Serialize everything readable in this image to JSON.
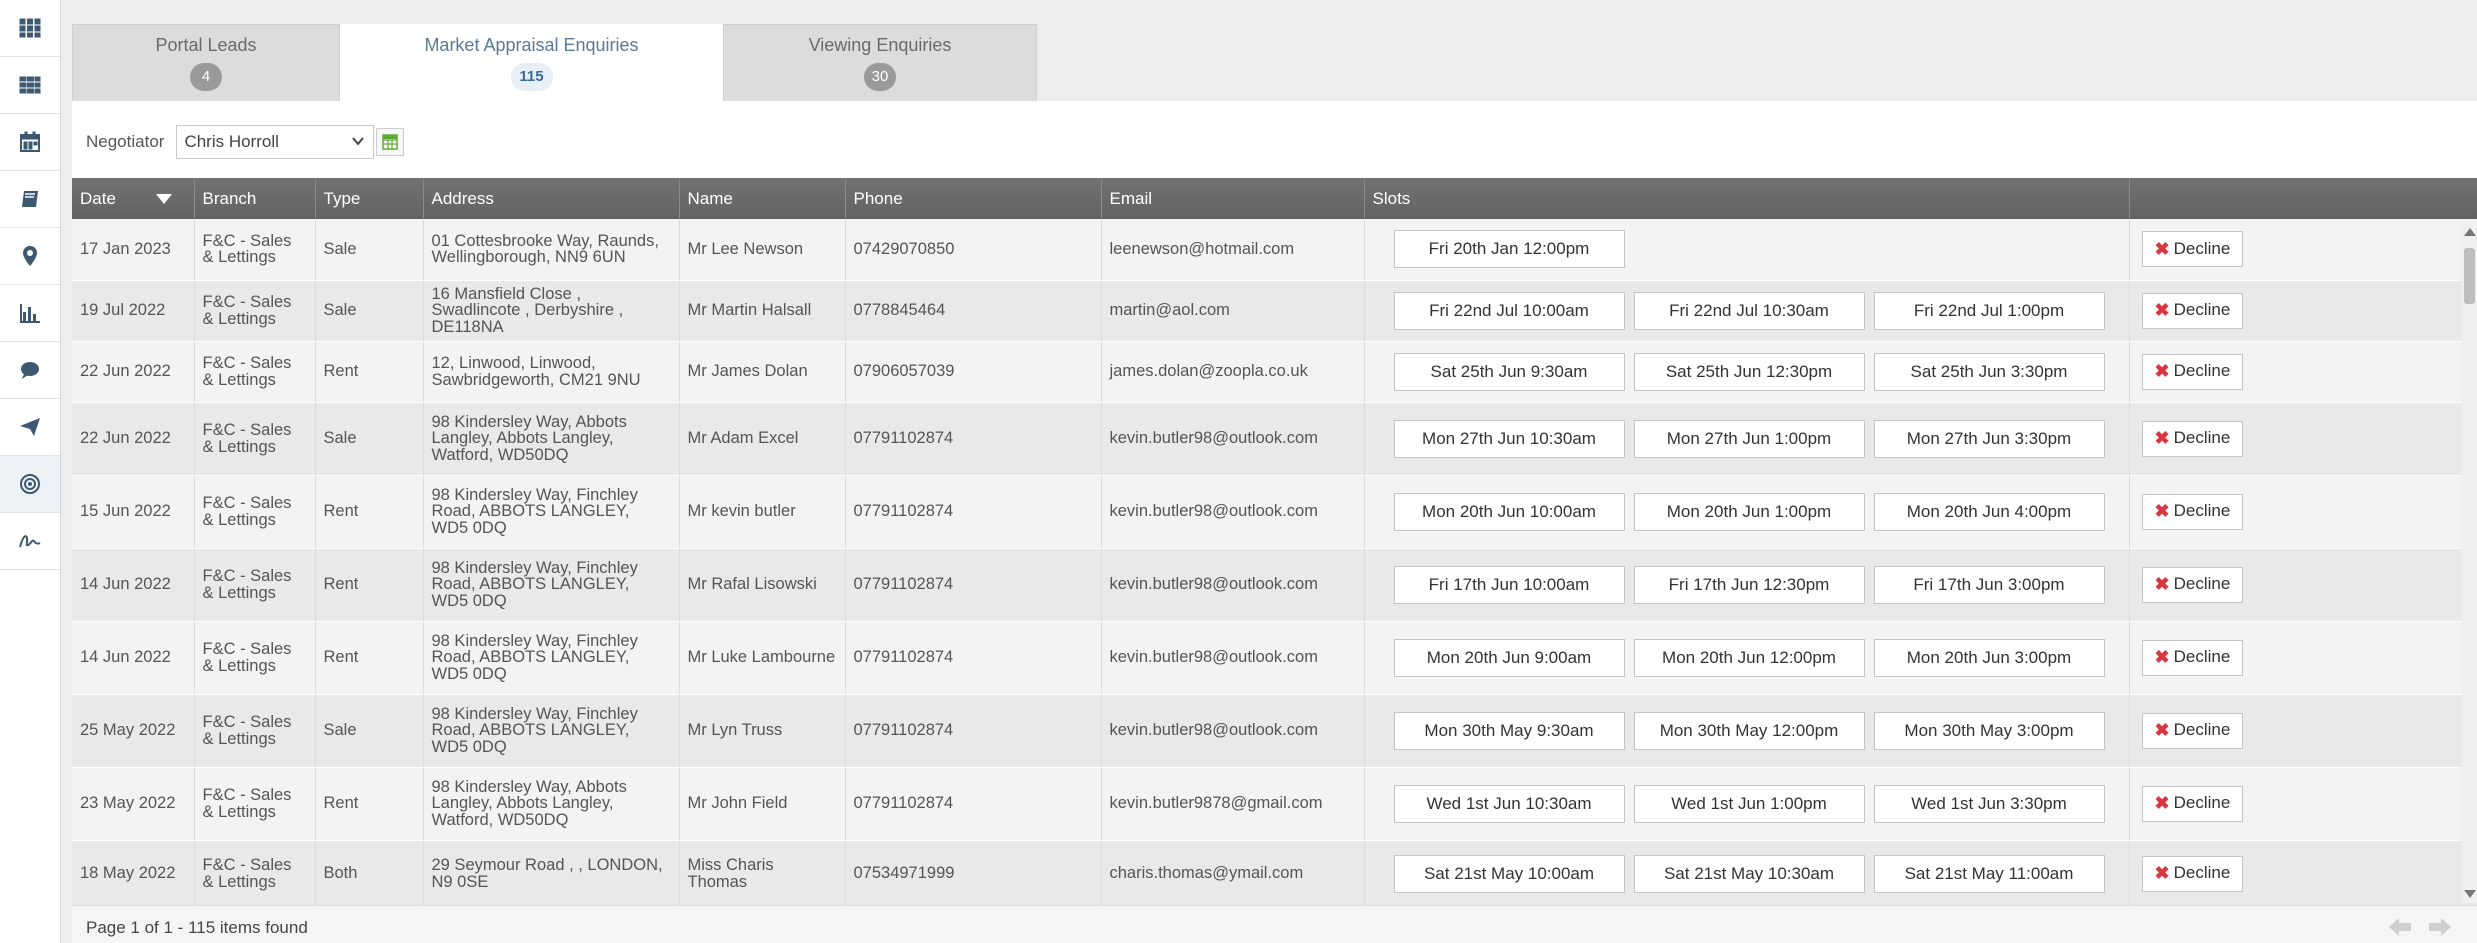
{
  "sidebar": {
    "icons": [
      "apps-grid-icon",
      "modules-grid-icon",
      "calendar-icon",
      "book-icon",
      "map-pin-icon",
      "bar-chart-icon",
      "chat-bubble-icon",
      "send-icon",
      "target-icon",
      "signature-icon"
    ]
  },
  "tabs": [
    {
      "label": "Portal Leads",
      "count": "4",
      "active": false
    },
    {
      "label": "Market Appraisal Enquiries",
      "count": "115",
      "active": true
    },
    {
      "label": "Viewing Enquiries",
      "count": "30",
      "active": false
    }
  ],
  "filter": {
    "label": "Negotiator",
    "value": "Chris Horroll"
  },
  "table": {
    "headers": [
      "Date",
      "Branch",
      "Type",
      "Address",
      "Name",
      "Phone",
      "Email",
      "Slots",
      ""
    ],
    "decline_label": "Decline",
    "rows": [
      {
        "date": "17 Jan 2023",
        "branch": "F&C - Sales & Lettings",
        "type": "Sale",
        "address": "01 Cottesbrooke Way, Raunds, Wellingborough, NN9 6UN",
        "name": "Mr Lee Newson",
        "phone": "07429070850",
        "email": "leenewson@hotmail.com",
        "slots": [
          "Fri 20th Jan 12:00pm"
        ]
      },
      {
        "date": "19 Jul 2022",
        "branch": "F&C - Sales & Lettings",
        "type": "Sale",
        "address": "16 Mansfield Close , Swadlincote , Derbyshire , DE118NA",
        "name": "Mr Martin Halsall",
        "phone": "0778845464",
        "email": "martin@aol.com",
        "slots": [
          "Fri 22nd Jul 10:00am",
          "Fri 22nd Jul 10:30am",
          "Fri 22nd Jul 1:00pm"
        ]
      },
      {
        "date": "22 Jun 2022",
        "branch": "F&C - Sales & Lettings",
        "type": "Rent",
        "address": "12, Linwood, Linwood, Sawbridgeworth, CM21 9NU",
        "name": "Mr James Dolan",
        "phone": "07906057039",
        "email": "james.dolan@zoopla.co.uk",
        "slots": [
          "Sat 25th Jun 9:30am",
          "Sat 25th Jun 12:30pm",
          "Sat 25th Jun 3:30pm"
        ]
      },
      {
        "date": "22 Jun 2022",
        "branch": "F&C - Sales & Lettings",
        "type": "Sale",
        "address": "98 Kindersley Way, Abbots Langley, Abbots Langley, Watford, WD50DQ",
        "name": "Mr Adam Excel",
        "phone": "07791102874",
        "email": "kevin.butler98@outlook.com",
        "slots": [
          "Mon 27th Jun 10:30am",
          "Mon 27th Jun 1:00pm",
          "Mon 27th Jun 3:30pm"
        ]
      },
      {
        "date": "15 Jun 2022",
        "branch": "F&C - Sales & Lettings",
        "type": "Rent",
        "address": "98 Kindersley Way, Finchley Road, ABBOTS LANGLEY, WD5 0DQ",
        "name": "Mr kevin butler",
        "phone": "07791102874",
        "email": "kevin.butler98@outlook.com",
        "slots": [
          "Mon 20th Jun 10:00am",
          "Mon 20th Jun 1:00pm",
          "Mon 20th Jun 4:00pm"
        ]
      },
      {
        "date": "14 Jun 2022",
        "branch": "F&C - Sales & Lettings",
        "type": "Rent",
        "address": "98 Kindersley Way, Finchley Road, ABBOTS LANGLEY, WD5 0DQ",
        "name": "Mr Rafal Lisowski",
        "phone": "07791102874",
        "email": "kevin.butler98@outlook.com",
        "slots": [
          "Fri 17th Jun 10:00am",
          "Fri 17th Jun 12:30pm",
          "Fri 17th Jun 3:00pm"
        ]
      },
      {
        "date": "14 Jun 2022",
        "branch": "F&C - Sales & Lettings",
        "type": "Rent",
        "address": "98 Kindersley Way, Finchley Road, ABBOTS LANGLEY, WD5 0DQ",
        "name": "Mr Luke Lambourne",
        "phone": "07791102874",
        "email": "kevin.butler98@outlook.com",
        "slots": [
          "Mon 20th Jun 9:00am",
          "Mon 20th Jun 12:00pm",
          "Mon 20th Jun 3:00pm"
        ]
      },
      {
        "date": "25 May 2022",
        "branch": "F&C - Sales & Lettings",
        "type": "Sale",
        "address": "98 Kindersley Way, Finchley Road, ABBOTS LANGLEY, WD5 0DQ",
        "name": "Mr Lyn Truss",
        "phone": "07791102874",
        "email": "kevin.butler98@outlook.com",
        "slots": [
          "Mon 30th May 9:30am",
          "Mon 30th May 12:00pm",
          "Mon 30th May 3:00pm"
        ]
      },
      {
        "date": "23 May 2022",
        "branch": "F&C - Sales & Lettings",
        "type": "Rent",
        "address": "98 Kindersley Way, Abbots Langley, Abbots Langley, Watford, WD50DQ",
        "name": "Mr John Field",
        "phone": "07791102874",
        "email": "kevin.butler9878@gmail.com",
        "slots": [
          "Wed 1st Jun 10:30am",
          "Wed 1st Jun 1:00pm",
          "Wed 1st Jun 3:30pm"
        ]
      },
      {
        "date": "18 May 2022",
        "branch": "F&C - Sales & Lettings",
        "type": "Both",
        "address": "29 Seymour Road , , LONDON, N9 0SE",
        "name": "Miss Charis Thomas",
        "phone": "07534971999",
        "email": "charis.thomas@ymail.com",
        "slots": [
          "Sat 21st May 10:00am",
          "Sat 21st May 10:30am",
          "Sat 21st May 11:00am"
        ]
      }
    ]
  },
  "footer": {
    "pager_text": "Page 1 of 1 - 115 items found"
  },
  "colors": {
    "header_bg": "#6b6b6b",
    "accent": "#3d5872",
    "decline_x": "#d9363e",
    "row_odd": "#f3f3f3",
    "row_even": "#e9e9e9"
  }
}
